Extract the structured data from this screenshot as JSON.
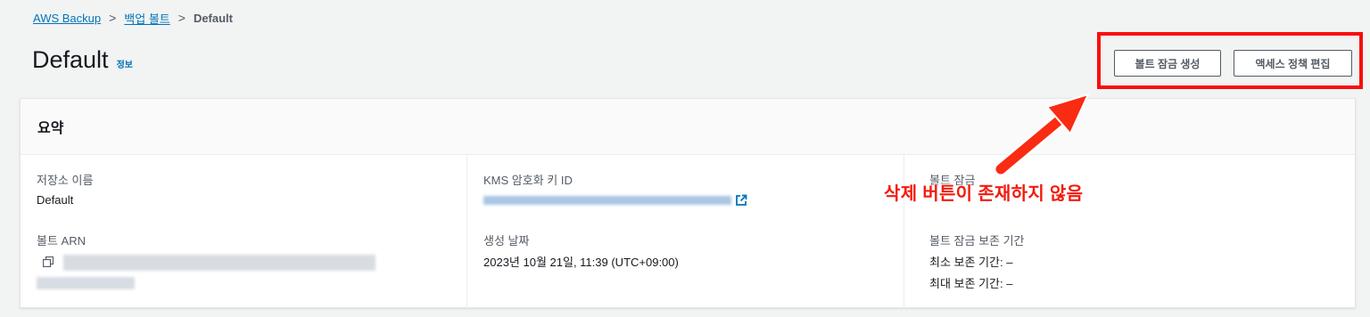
{
  "breadcrumb": {
    "root": "AWS Backup",
    "vaults": "백업 볼트",
    "current": "Default"
  },
  "header": {
    "title": "Default",
    "info": "정보",
    "create_lock_button": "볼트 잠금 생성",
    "edit_policy_button": "액세스 정책 편집"
  },
  "summary": {
    "heading": "요약",
    "vault_name_label": "저장소 이름",
    "vault_name_value": "Default",
    "vault_arn_label": "볼트 ARN",
    "kms_key_label": "KMS 암호화 키 ID",
    "creation_date_label": "생성 날짜",
    "creation_date_value": "2023년 10월 21일, 11:39 (UTC+09:00)",
    "vault_lock_label": "볼트 잠금",
    "retention_label": "볼트 잠금 보존 기간",
    "min_retention": "최소 보존 기간: –",
    "max_retention": "최대 보존 기간: –"
  },
  "annotation": {
    "text": "삭제 버튼이 존재하지 않음",
    "color": "#f31a0c"
  },
  "colors": {
    "link": "#0073bb",
    "background": "#f2f3f3",
    "highlight": "#f90d0d"
  }
}
